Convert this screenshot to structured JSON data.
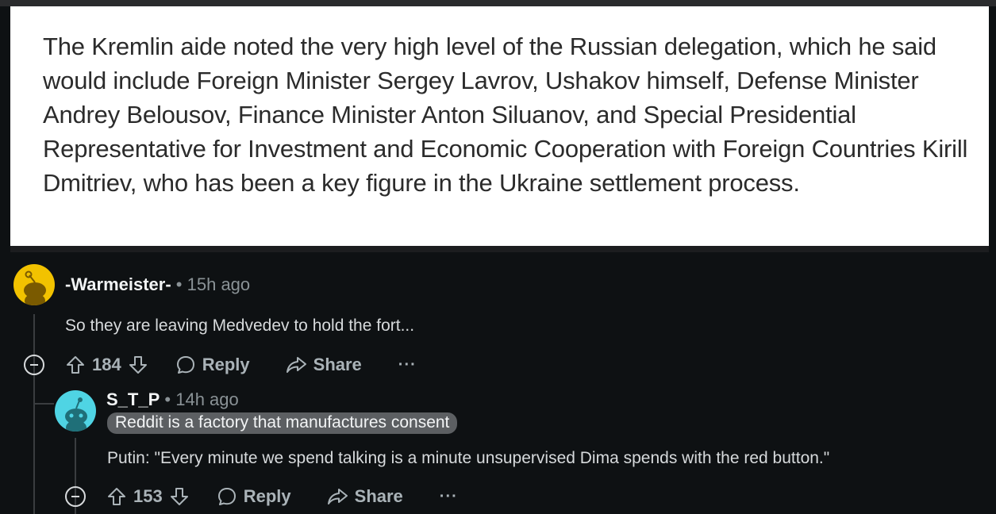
{
  "post_image": {
    "text": "The Kremlin aide noted the very high level of the Russian delegation, which he said would include Foreign Minister Sergey Lavrov, Ushakov himself, Defense Minister Andrey Belousov, Finance Minister Anton Siluanov, and Special Presidential Representative for Investment and Economic Cooperation with Foreign Countries Kirill Dmitriev, who has been a key figure in the Ukraine settlement process."
  },
  "comments": [
    {
      "author": "-Warmeister-",
      "separator": "•",
      "time": "15h ago",
      "body": "So they are leaving Medvedev to hold the fort...",
      "votes": "184",
      "reply_label": "Reply",
      "share_label": "Share",
      "more_label": "···",
      "avatar_color": "#f2c200"
    },
    {
      "author": "S_T_P",
      "separator": "•",
      "time": "14h ago",
      "flair": "Reddit is a factory that manufactures consent",
      "body": "Putin: \"Every minute we spend talking is a minute unsupervised Dima spends with the red button.\"",
      "votes": "153",
      "reply_label": "Reply",
      "share_label": "Share",
      "more_label": "···",
      "avatar_color": "#4fd4e4"
    }
  ],
  "colors": {
    "background": "#0e1113",
    "text_muted": "#8a9296",
    "action_text": "#aab3b8"
  }
}
